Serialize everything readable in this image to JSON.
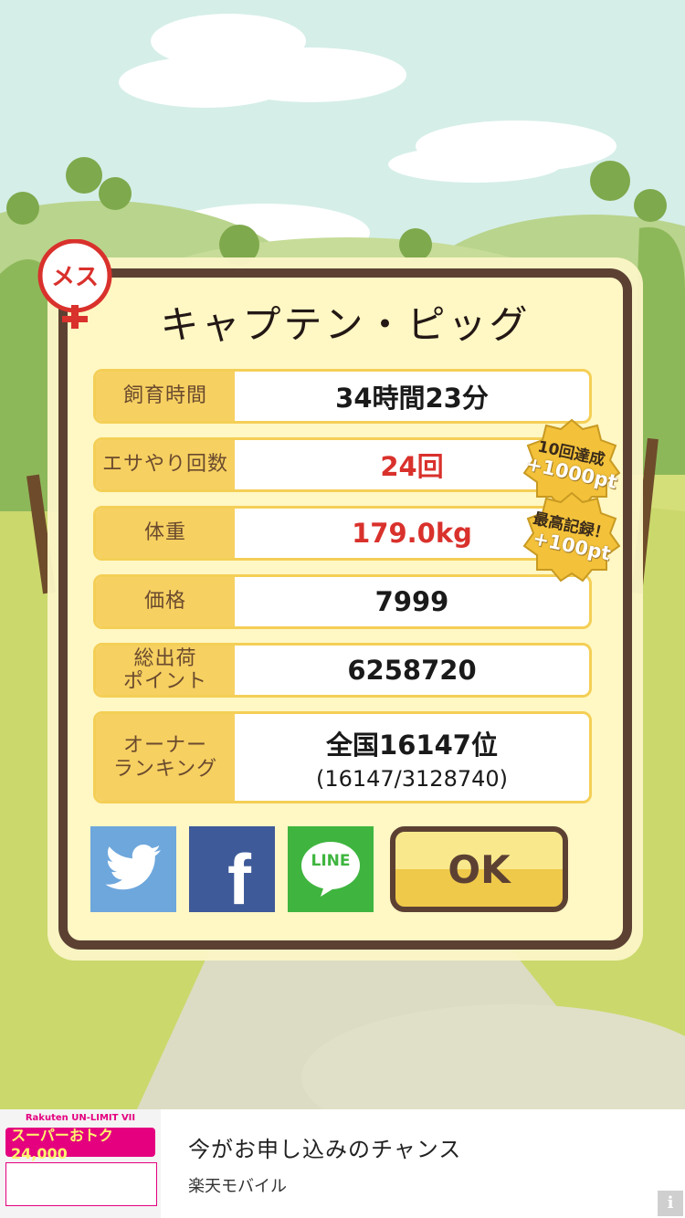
{
  "pig": {
    "name": "キャプテン・ピッグ",
    "gender_badge": "メス"
  },
  "stats": [
    {
      "label": "飼育時間",
      "value": "34時間23分"
    },
    {
      "label": "エサやり回数",
      "value": "24回"
    },
    {
      "label": "体重",
      "value": "179.0kg"
    },
    {
      "label": "価格",
      "value": "7999"
    },
    {
      "label": "総出荷\nポイント",
      "value": "6258720"
    },
    {
      "label": "オーナー\nランキング",
      "value": "全国16147位",
      "sub": "(16147/3128740)"
    }
  ],
  "bonuses": [
    {
      "line1": "10回達成",
      "line2": "+1000pt"
    },
    {
      "line1": "最高記録！",
      "line2": "+100pt"
    }
  ],
  "share": {
    "twitter": "twitter-icon",
    "facebook": "f",
    "line": "LINE"
  },
  "ok_label": "OK",
  "ad": {
    "brand": "Rakuten UN-LIMIT VII",
    "banner": "スーパーおトク 24,000",
    "title": "今がお申し込みのチャンス",
    "advertiser": "楽天モバイル",
    "info": "i"
  },
  "colors": {
    "frame_brown": "#5c4133",
    "label_yellow": "#f6d061",
    "highlight_red": "#d9312c",
    "twitter_blue": "#6ea7dc",
    "facebook_blue": "#3e5a99",
    "line_green": "#3fb53f"
  }
}
